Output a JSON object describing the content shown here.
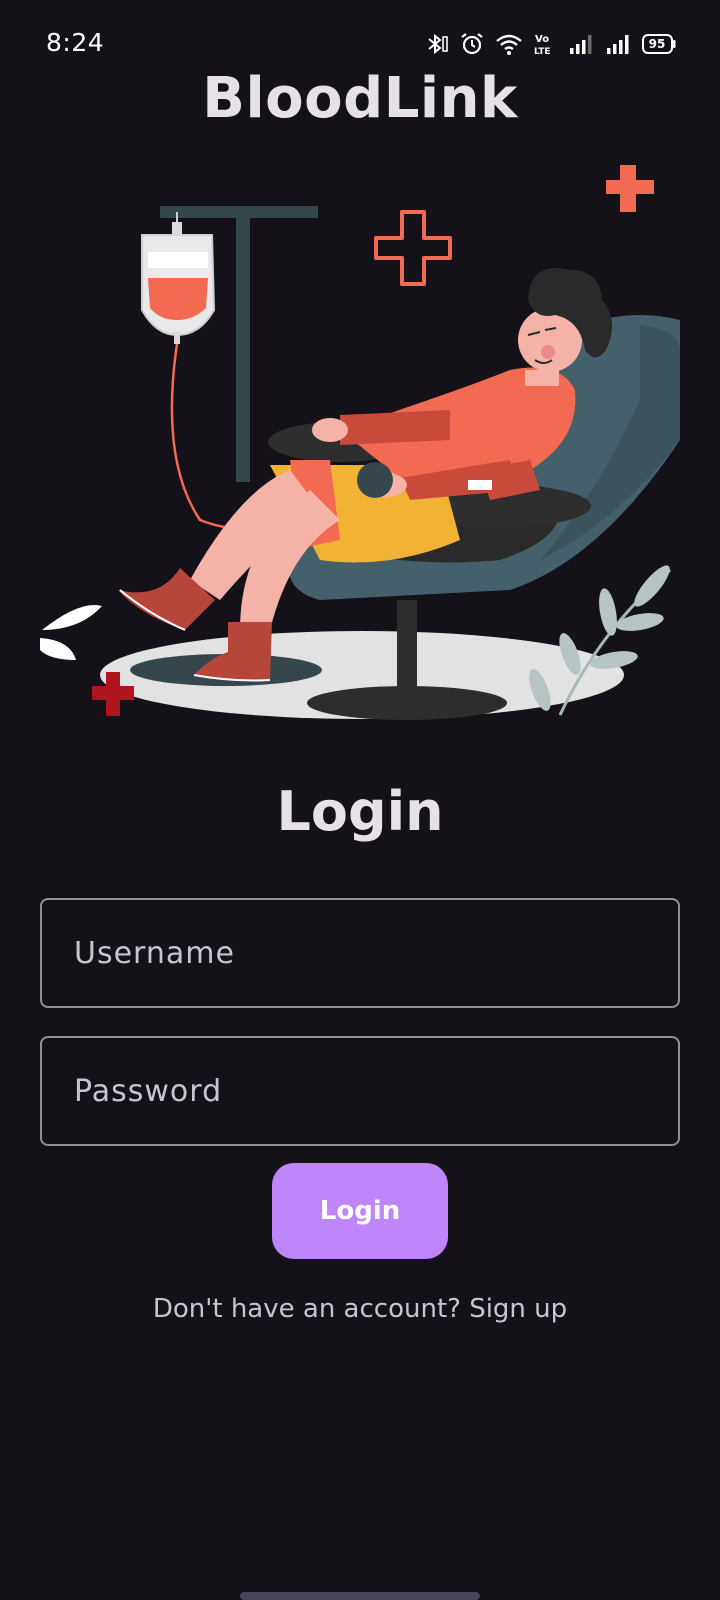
{
  "status_bar": {
    "time": "8:24",
    "battery_level": "95",
    "icons": [
      "bluetooth-icon",
      "alarm-icon",
      "wifi-icon",
      "volte-icon",
      "signal-icon",
      "signal-icon",
      "battery-icon"
    ]
  },
  "app": {
    "title": "BloodLink"
  },
  "login": {
    "title": "Login",
    "username_placeholder": "Username",
    "password_placeholder": "Password",
    "button_label": "Login",
    "signup_text": "Don't have an account? Sign up"
  },
  "colors": {
    "background": "#141218",
    "accent": "#bf86fc",
    "illustration_red": "#f26a52"
  }
}
